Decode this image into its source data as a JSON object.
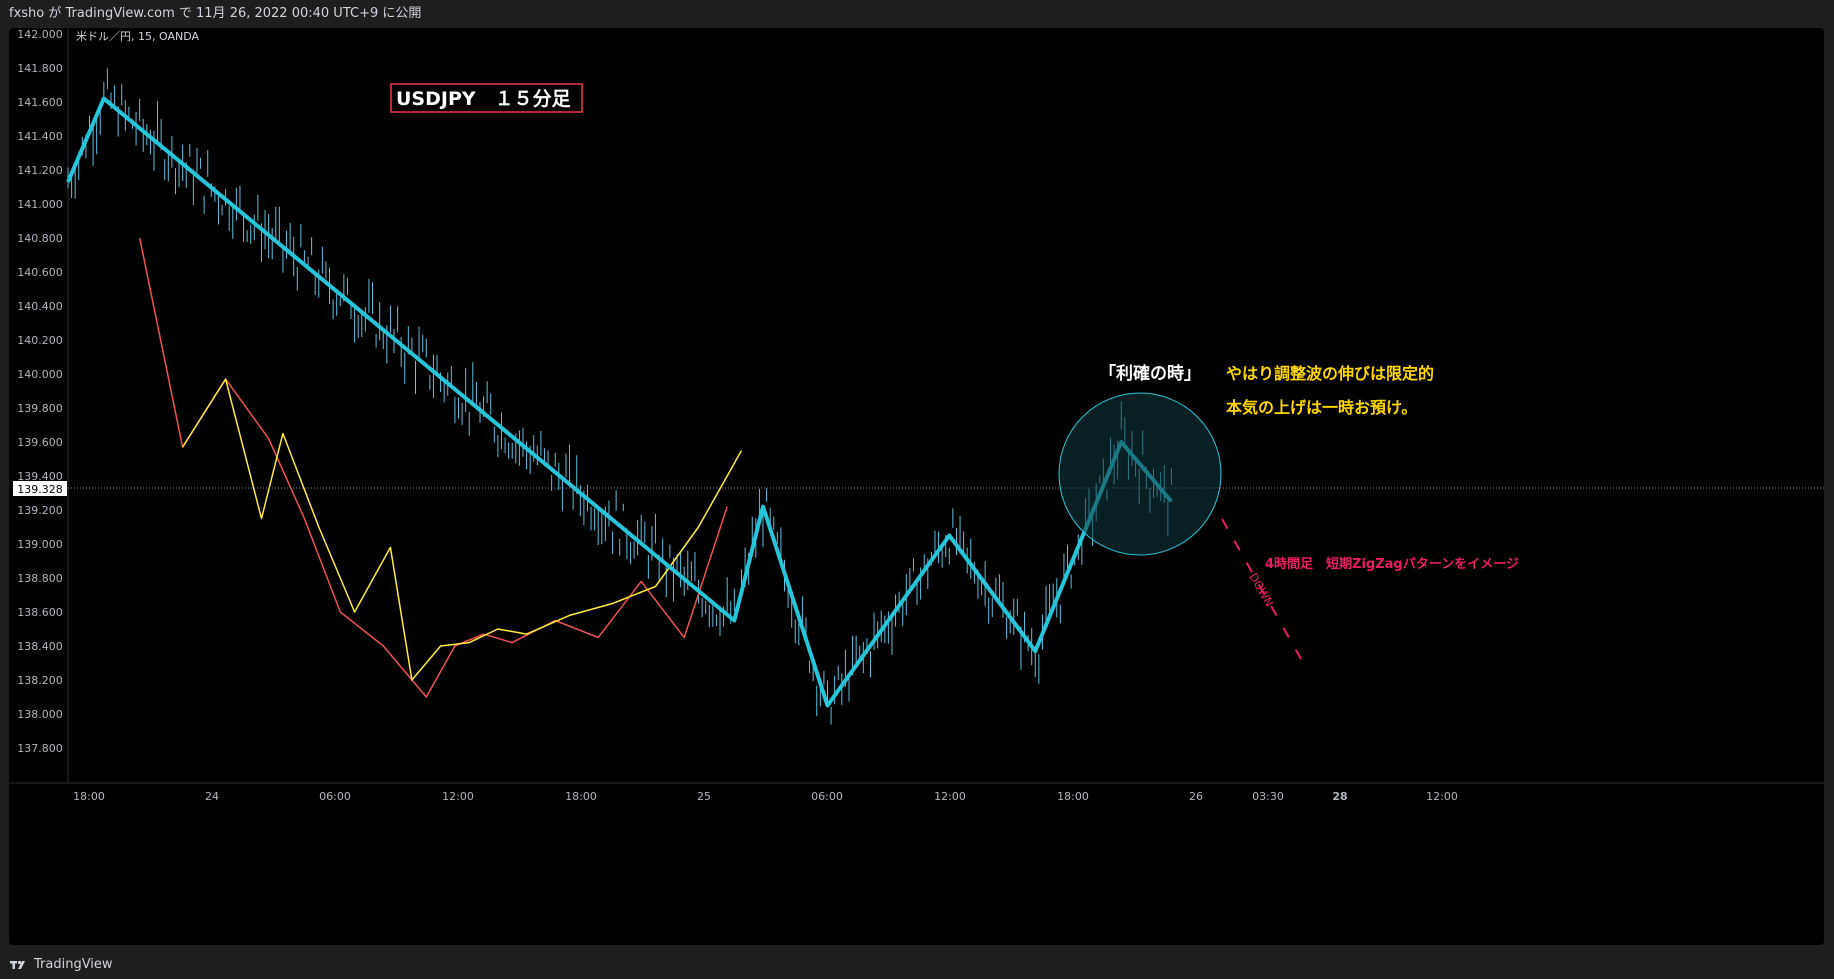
{
  "header": {
    "publish_text": "fxsho が TradingView.com で 11月 26, 2022 00:40 UTC+9 に公開"
  },
  "symbol_label": "米ドル／円, 15, OANDA",
  "chart_title_box": "USDJPY　１５分足",
  "price_label": "139.328",
  "annotations": {
    "take_profit": "「利確の時」",
    "comment_line1": "やはり調整波の伸びは限定的",
    "comment_line2": "本気の上げは一時お預け。",
    "down_label": "DOWN",
    "pattern_note": "4時間足　短期ZigZagパターンをイメージ"
  },
  "footer": {
    "brand": "TradingView"
  },
  "colors": {
    "background": "#000000",
    "frame": "#1e1e1f",
    "candle": "#5bc0de",
    "zigzag_long": "#26c6da",
    "zigzag_white": "#ffffff",
    "zigzag_yellow": "#ffeb3b",
    "zigzag_red": "#ef5350",
    "annotation_yellow": "#ffd600",
    "annotation_pink": "#e91e63",
    "title_box_border": "#f23645"
  },
  "chart_data": {
    "type": "line",
    "instrument": "USDJPY",
    "timeframe": "15",
    "source": "OANDA",
    "y_ticks": [
      "142.000",
      "141.800",
      "141.600",
      "141.400",
      "141.200",
      "141.000",
      "140.800",
      "140.600",
      "140.400",
      "140.200",
      "140.000",
      "139.800",
      "139.600",
      "139.400",
      "139.200",
      "139.000",
      "138.800",
      "138.600",
      "138.400",
      "138.200",
      "138.000",
      "137.800"
    ],
    "ylim": [
      137.6,
      142.05
    ],
    "x_ticks": [
      "18:00",
      "24",
      "06:00",
      "12:00",
      "18:00",
      "25",
      "06:00",
      "12:00",
      "18:00",
      "26",
      "03:30",
      "28",
      "12:00"
    ],
    "last_price": 139.328,
    "series": [
      {
        "style": "long",
        "x": [
          0,
          2.5,
          46.5,
          48.5,
          53,
          61.5,
          67.5,
          73.5,
          77
        ],
        "values": [
          141.13,
          141.62,
          138.55,
          139.22,
          138.05,
          139.05,
          138.37,
          139.6,
          139.25
        ]
      },
      {
        "style": "white",
        "x": [
          2.5,
          46.5,
          48.5,
          53,
          61.5,
          67.5
        ],
        "values": [
          141.62,
          138.55,
          139.22,
          138.05,
          139.05,
          138.37
        ]
      },
      {
        "style": "yellow",
        "x": [
          8,
          11,
          13.5,
          15,
          17.5,
          20,
          22.5,
          24,
          26,
          28,
          30,
          32,
          35,
          38,
          41,
          44,
          47
        ],
        "values": [
          139.57,
          139.97,
          139.15,
          139.65,
          139.1,
          138.6,
          138.98,
          138.2,
          138.4,
          138.42,
          138.5,
          138.47,
          138.58,
          138.65,
          138.75,
          139.1,
          139.55
        ]
      },
      {
        "style": "red",
        "x": [
          5,
          8,
          11,
          14,
          16.5,
          19,
          22,
          25,
          27,
          29,
          31,
          34,
          37,
          40,
          43,
          46
        ],
        "values": [
          140.8,
          139.57,
          139.97,
          139.62,
          139.15,
          138.6,
          138.4,
          138.1,
          138.4,
          138.47,
          138.42,
          138.55,
          138.45,
          138.78,
          138.45,
          139.22
        ]
      }
    ]
  }
}
